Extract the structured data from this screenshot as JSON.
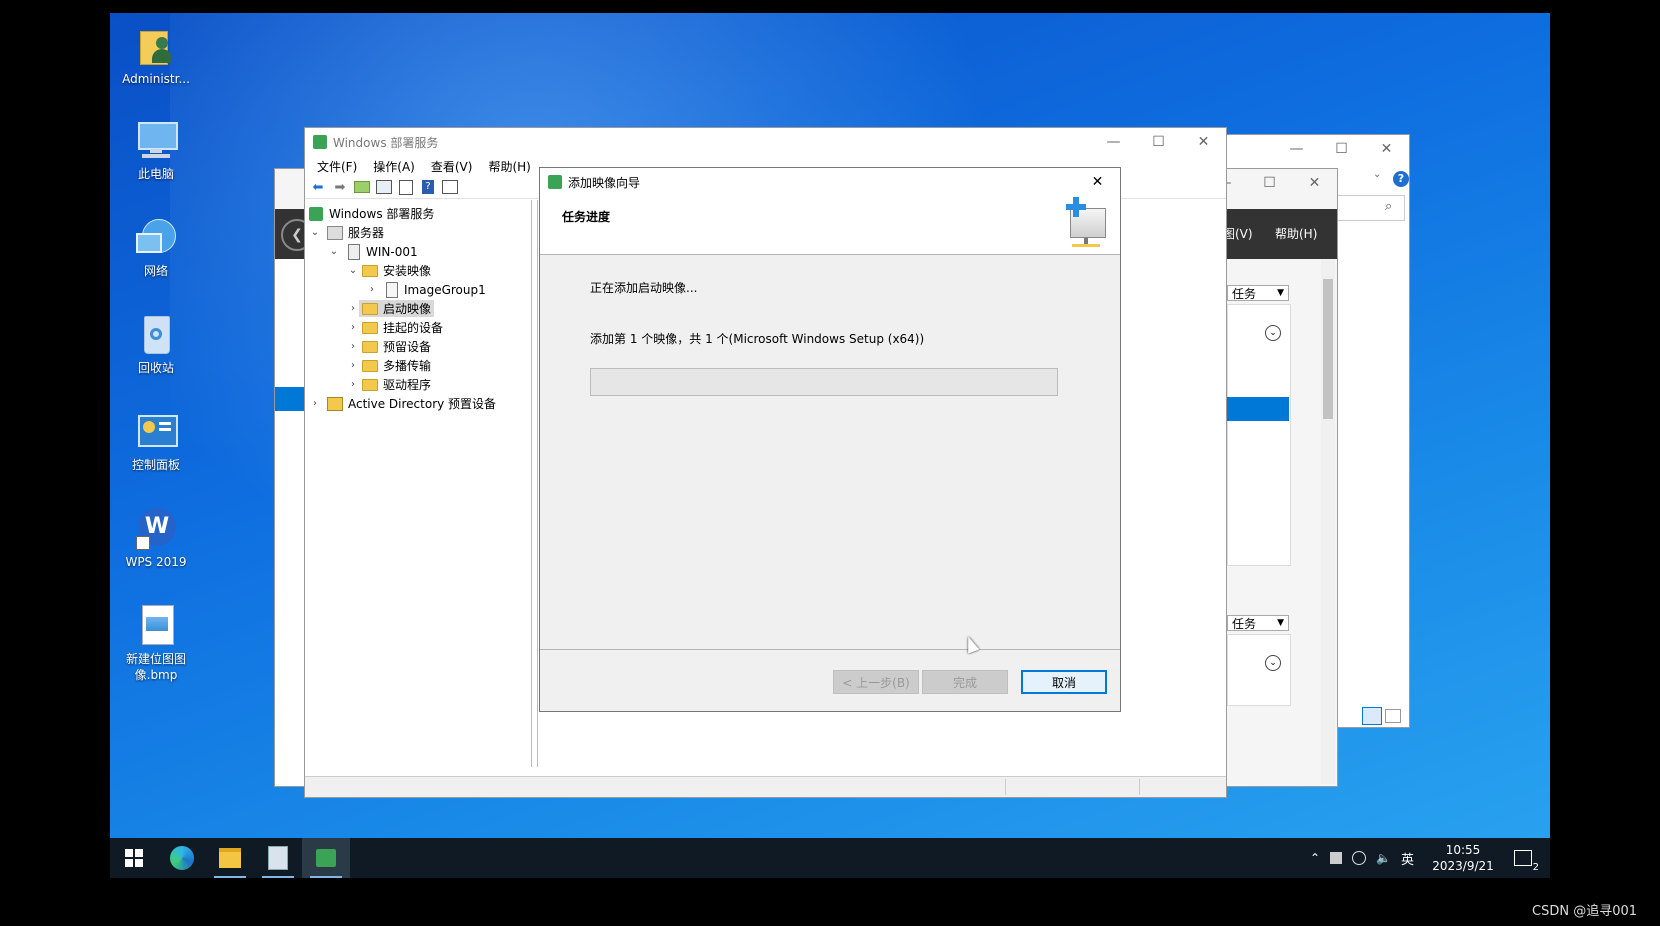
{
  "desktop": {
    "icons": [
      {
        "label": "Administr...",
        "icon": "user-folder-icon"
      },
      {
        "label": "此电脑",
        "icon": "computer-icon"
      },
      {
        "label": "网络",
        "icon": "network-icon"
      },
      {
        "label": "回收站",
        "icon": "recycle-bin-icon"
      },
      {
        "label": "控制面板",
        "icon": "control-panel-icon"
      },
      {
        "label": "WPS 2019",
        "icon": "wps-icon"
      },
      {
        "label": "新建位图图像.bmp",
        "icon": "bitmap-file-icon"
      }
    ]
  },
  "back_window": {
    "menu_view": "图(V)",
    "menu_help": "帮助(H)",
    "tasks_label_1": "任务",
    "tasks_label_2": "任务",
    "help_glyph": "?"
  },
  "main_window": {
    "title": "Windows 部署服务",
    "menu": [
      "文件(F)",
      "操作(A)",
      "查看(V)",
      "帮助(H)"
    ],
    "tree": {
      "root": "Windows 部署服务",
      "servers": "服务器",
      "server_name": "WIN-001",
      "install_images": "安装映像",
      "image_group": "ImageGroup1",
      "boot_images": "启动映像",
      "pending_devices": "挂起的设备",
      "prestaged_devices": "预留设备",
      "multicast": "多播传输",
      "drivers": "驱动程序",
      "ad_prestaged": "Active Directory 预置设备"
    }
  },
  "wizard": {
    "title": "添加映像向导",
    "section_title": "任务进度",
    "status_text": "正在添加启动映像...",
    "detail_text": "添加第 1 个映像，共 1 个(Microsoft Windows Setup (x64))",
    "progress": 0,
    "back_button": "< 上一步(B)",
    "finish_button": "完成",
    "cancel_button": "取消"
  },
  "taskbar": {
    "apps": [
      "start-icon",
      "edge-icon",
      "file-explorer-icon",
      "server-manager-icon",
      "wds-icon"
    ],
    "ime": "英",
    "time": "10:55",
    "date": "2023/9/21",
    "notification_count": "2",
    "watermark": "CSDN @追寻001"
  },
  "colors": {
    "accent": "#0078d7",
    "selection": "#0078d7",
    "taskbar": "#101a24"
  }
}
